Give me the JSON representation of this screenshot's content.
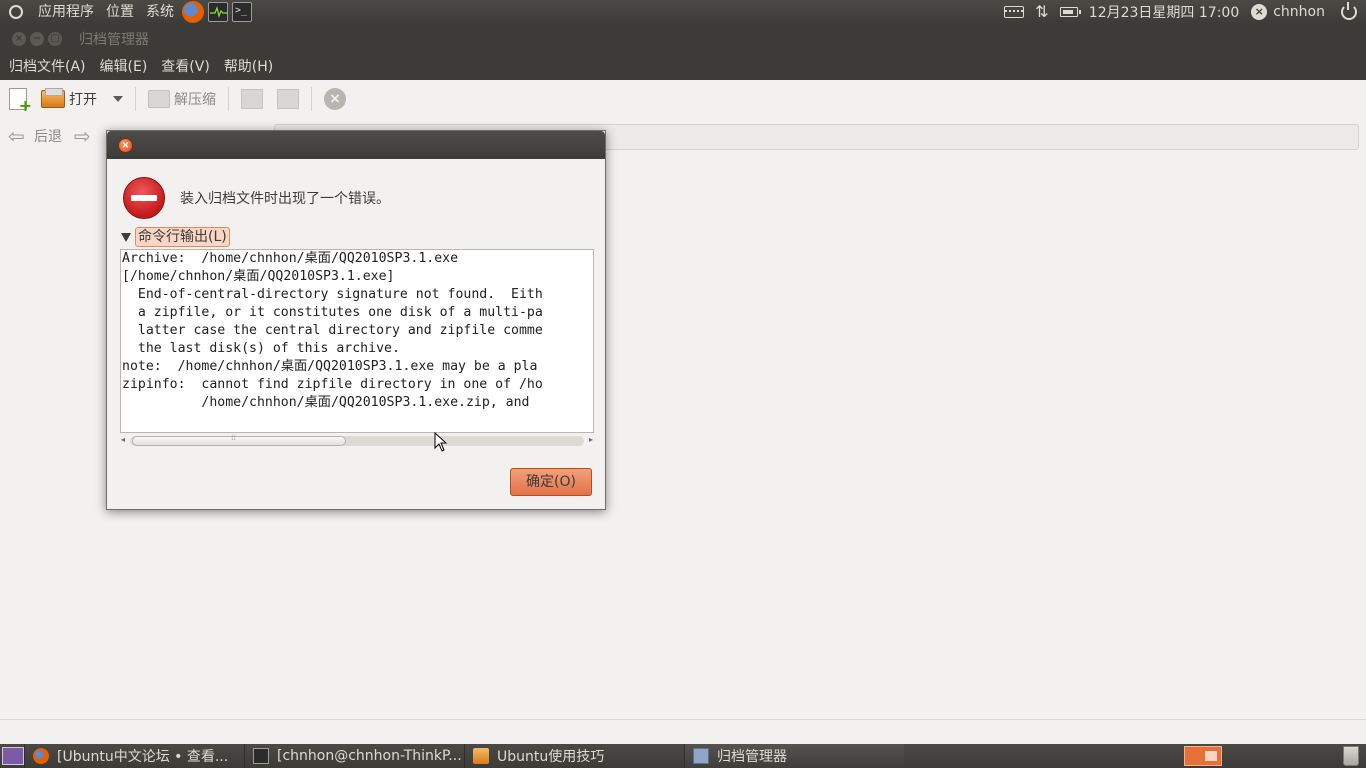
{
  "top_panel": {
    "menus": [
      "应用程序",
      "位置",
      "系统"
    ],
    "clock": "12月23日星期四 17:00",
    "username": "chnhon"
  },
  "window": {
    "title": "归档管理器",
    "menubar": [
      "归档文件(A)",
      "编辑(E)",
      "查看(V)",
      "帮助(H)"
    ],
    "toolbar": {
      "open_label": "打开",
      "extract_label": "解压缩"
    },
    "location": {
      "back_label": "后退"
    }
  },
  "dialog": {
    "message": "装入归档文件时出现了一个错误。",
    "expander_label": "命令行输出(L)",
    "output_lines": [
      "Archive:  /home/chnhon/桌面/QQ2010SP3.1.exe",
      "[/home/chnhon/桌面/QQ2010SP3.1.exe]",
      "  End-of-central-directory signature not found.  Eith",
      "  a zipfile, or it constitutes one disk of a multi-pa",
      "  latter case the central directory and zipfile comme",
      "  the last disk(s) of this archive.",
      "note:  /home/chnhon/桌面/QQ2010SP3.1.exe may be a pla",
      "zipinfo:  cannot find zipfile directory in one of /ho",
      "          /home/chnhon/桌面/QQ2010SP3.1.exe.zip, and"
    ],
    "ok_label": "确定(O)"
  },
  "taskbar": {
    "tasks": [
      {
        "label": "[Ubuntu中文论坛 • 查看...",
        "icon": "firefox-icon"
      },
      {
        "label": "[chnhon@chnhon-ThinkP...",
        "icon": "terminal-icon"
      },
      {
        "label": "Ubuntu使用技巧",
        "icon": "folder-icon"
      },
      {
        "label": "归档管理器",
        "icon": "archive-manager-icon"
      }
    ]
  },
  "colors": {
    "panel": "#3c3b37",
    "accent": "#e2734a",
    "error": "#c4191a"
  }
}
